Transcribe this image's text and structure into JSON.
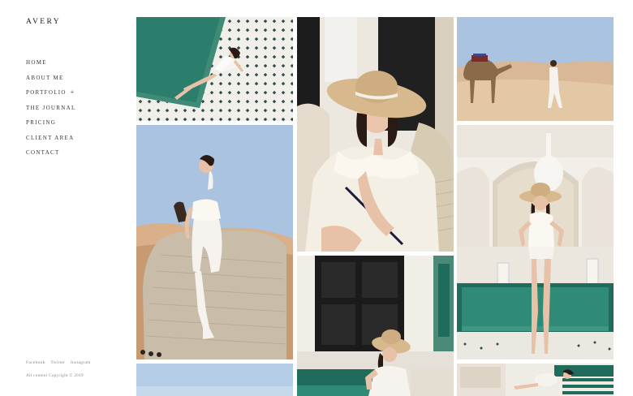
{
  "brand": {
    "logo": "AVERY"
  },
  "nav": {
    "items": [
      "HOME",
      "ABOUT ME",
      "PORTFOLIO",
      "THE JOURNAL",
      "PRICING",
      "CLIENT AREA",
      "CONTACT"
    ],
    "portfolio_expand": "+"
  },
  "footer": {
    "social": [
      "Facebook",
      "Twitter",
      "Instagram"
    ],
    "copyright": "All content Copyright © 2019"
  },
  "gallery": {
    "photos": [
      "woman-lounging-on-tiled-poolside",
      "woman-in-straw-hat-on-wicker-chair",
      "woman-walking-with-camel-in-desert",
      "woman-seated-on-camel-in-desert",
      "woman-in-swimsuit-by-courtyard-pool",
      "woman-in-hat-by-black-door",
      "desert-sky-partial",
      "woman-lying-on-striped-cushion"
    ]
  },
  "colors": {
    "pool_green": "#1f6b5c",
    "tile_white": "#f2f0ec",
    "sky_blue": "#a9c3e0",
    "sand": "#d8b896",
    "straw": "#d7b98d",
    "skin": "#e8c2a8",
    "dark_hair": "#2a1a14"
  }
}
